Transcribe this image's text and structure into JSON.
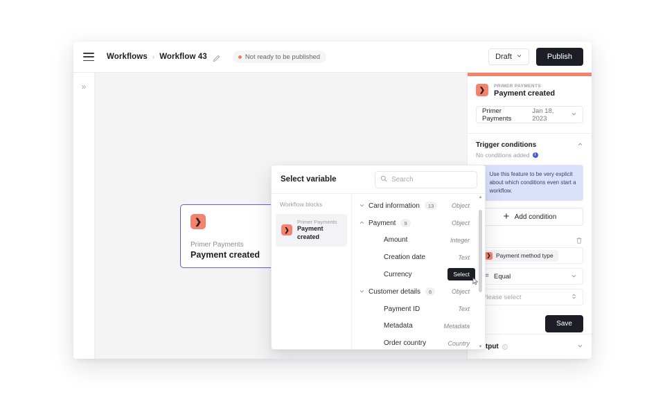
{
  "header": {
    "menu_icon": "hamburger-icon",
    "breadcrumb": [
      {
        "label": "Workflows"
      },
      {
        "label": "Workflow 43"
      }
    ],
    "separator": "›",
    "edit_icon": "pencil-icon",
    "status_badge": "Not ready to be published",
    "status_color": "#f4795f",
    "draft_label": "Draft",
    "publish_label": "Publish"
  },
  "rail": {
    "expand_icon": "»"
  },
  "canvas": {
    "node": {
      "icon_glyph": "❯",
      "subtitle": "Primer Payments",
      "title": "Payment created",
      "accent": "#f4836d",
      "border_color": "#5b5fe0",
      "play_icon": "play-icon"
    }
  },
  "modal": {
    "title": "Select variable",
    "search_placeholder": "Search",
    "search_value": "",
    "close_icon": "×",
    "left_label": "Workflow blocks",
    "block": {
      "icon_glyph": "❯",
      "subtitle": "Primer Payments",
      "name": "Payment created"
    },
    "select_chip": "Select",
    "variables": [
      {
        "name": "Card information",
        "count": "13",
        "type": "Object",
        "caret": "⌄",
        "indent": false,
        "expanded": false
      },
      {
        "name": "Payment",
        "count": "9",
        "type": "Object",
        "caret": "⌃",
        "indent": false,
        "expanded": true
      },
      {
        "name": "Amount",
        "count": "",
        "type": "Integer",
        "caret": "",
        "indent": true
      },
      {
        "name": "Creation date",
        "count": "",
        "type": "Text",
        "caret": "",
        "indent": true
      },
      {
        "name": "Currency",
        "count": "",
        "type": "",
        "caret": "",
        "indent": true,
        "hovered": true
      },
      {
        "name": "Customer details",
        "count": "6",
        "type": "Object",
        "caret": "⌄",
        "indent": false
      },
      {
        "name": "Payment ID",
        "count": "",
        "type": "Text",
        "caret": "",
        "indent": true
      },
      {
        "name": "Metadata",
        "count": "",
        "type": "Metadata",
        "caret": "",
        "indent": true
      },
      {
        "name": "Order country",
        "count": "",
        "type": "Country",
        "caret": "",
        "indent": true
      }
    ]
  },
  "panel": {
    "accent_color": "#f4836d",
    "icon_glyph": "❯",
    "eyebrow": "PRIMER PAYMENTS",
    "title": "Payment created",
    "source_select": {
      "primary": "Primer Payments",
      "secondary": "Jan 18, 2023",
      "caret": "⌄"
    },
    "trigger": {
      "title": "Trigger conditions",
      "caret": "⌃",
      "empty_text": "No conditions added",
      "info_glyph": "i",
      "callout": "Use this feature to be very explicit about which conditions even start a workflow.",
      "callout_color": "#dbe1fb",
      "add_label": "Add condition",
      "add_icon": "plus-icon"
    },
    "condition": {
      "delete_icon": "trash-icon",
      "variable_chip": "Payment method type",
      "variable_icon_glyph": "❯",
      "operator_icon": "operator-icon",
      "operator_label": "Equal",
      "operator_caret": "⌄",
      "value_placeholder": "Please select",
      "value_caret": "↕"
    },
    "save_label": "Save",
    "output": {
      "title": "Output",
      "info_glyph": "i",
      "caret": "⌄"
    }
  }
}
